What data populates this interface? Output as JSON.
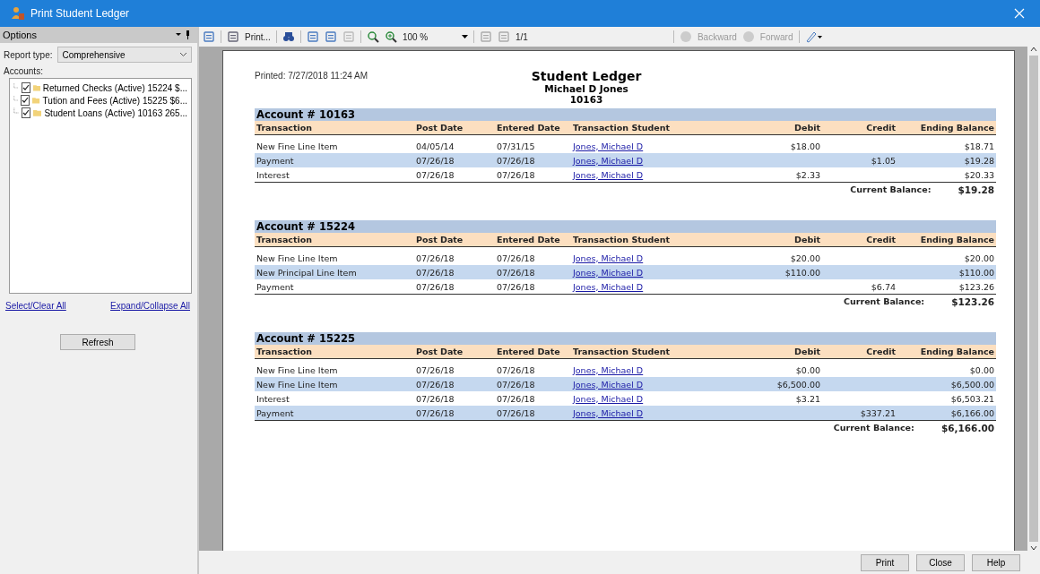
{
  "window": {
    "title": "Print Student Ledger"
  },
  "options": {
    "title": "Options",
    "report_type_label": "Report type:",
    "report_type": "Comprehensive",
    "accounts_label": "Accounts:",
    "accounts": [
      {
        "label": "Returned Checks  (Active)  15224  $...",
        "checked": true
      },
      {
        "label": "Tution and Fees  (Active)  15225  $6...",
        "checked": true
      },
      {
        "label": "Student Loans  (Active)  10163  265...",
        "checked": true
      }
    ],
    "select_clear": "Select/Clear All",
    "expand_collapse": "Expand/Collapse All",
    "refresh": "Refresh"
  },
  "toolbar": {
    "print": "Print...",
    "zoom": "100 %",
    "page": "1/1",
    "backward": "Backward",
    "forward": "Forward"
  },
  "report": {
    "printed": "Printed: 7/27/2018 11:24 AM",
    "title": "Student Ledger",
    "student": "Michael D Jones",
    "student_id": "10163",
    "accounts": [
      {
        "title": "Account # 10163",
        "columns": [
          "Transaction",
          "Post Date",
          "Entered Date",
          "Transaction Student",
          "Debit",
          "Credit",
          "Ending Balance"
        ],
        "balance_label": "Current Balance:",
        "balance": "$19.28",
        "rows": [
          [
            "New Fine Line Item",
            "04/05/14",
            "07/31/15",
            "Jones, Michael D",
            "$18.00",
            "",
            "$18.71"
          ],
          [
            "Payment",
            "07/26/18",
            "07/26/18",
            "Jones, Michael D",
            "",
            "$1.05",
            "$19.28"
          ],
          [
            "Interest",
            "07/26/18",
            "07/26/18",
            "Jones, Michael D",
            "$2.33",
            "",
            "$20.33"
          ]
        ]
      },
      {
        "title": "Account # 15224",
        "columns": [
          "Transaction",
          "Post Date",
          "Entered Date",
          "Transaction Student",
          "Debit",
          "Credit",
          "Ending Balance"
        ],
        "balance_label": "Current Balance:",
        "balance": "$123.26",
        "rows": [
          [
            "New Fine Line Item",
            "07/26/18",
            "07/26/18",
            "Jones, Michael D",
            "$20.00",
            "",
            "$20.00"
          ],
          [
            "New Principal Line Item",
            "07/26/18",
            "07/26/18",
            "Jones, Michael D",
            "$110.00",
            "",
            "$110.00"
          ],
          [
            "Payment",
            "07/26/18",
            "07/26/18",
            "Jones, Michael D",
            "",
            "$6.74",
            "$123.26"
          ]
        ]
      },
      {
        "title": "Account # 15225",
        "columns": [
          "Transaction",
          "Post Date",
          "Entered Date",
          "Transaction Student",
          "Debit",
          "Credit",
          "Ending Balance"
        ],
        "balance_label": "Current Balance:",
        "balance": "$6,166.00",
        "rows": [
          [
            "New Fine Line Item",
            "07/26/18",
            "07/26/18",
            "Jones, Michael D",
            "$0.00",
            "",
            "$0.00"
          ],
          [
            "New Fine Line Item",
            "07/26/18",
            "07/26/18",
            "Jones, Michael D",
            "$6,500.00",
            "",
            "$6,500.00"
          ],
          [
            "Interest",
            "07/26/18",
            "07/26/18",
            "Jones, Michael D",
            "$3.21",
            "",
            "$6,503.21"
          ],
          [
            "Payment",
            "07/26/18",
            "07/26/18",
            "Jones, Michael D",
            "",
            "$337.21",
            "$6,166.00"
          ]
        ]
      }
    ]
  },
  "buttons": [
    "Print",
    "Close",
    "Help"
  ]
}
